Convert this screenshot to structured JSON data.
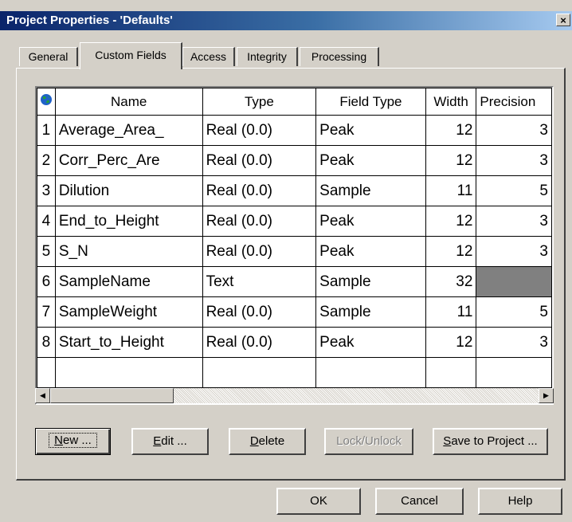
{
  "window": {
    "title": "Project Properties - 'Defaults'",
    "close_glyph": "×"
  },
  "tabs": [
    {
      "label": "General",
      "active": false
    },
    {
      "label": "Custom Fields",
      "active": true
    },
    {
      "label": "Access",
      "active": false
    },
    {
      "label": "Integrity",
      "active": false
    },
    {
      "label": "Processing",
      "active": false
    }
  ],
  "grid": {
    "corner_icon": "globe-icon",
    "columns": [
      "Name",
      "Type",
      "Field Type",
      "Width",
      "Precision"
    ],
    "rows": [
      {
        "num": "1",
        "name": "Average_Area_",
        "type": "Real (0.0)",
        "field_type": "Peak",
        "width": "12",
        "precision": "3"
      },
      {
        "num": "2",
        "name": "Corr_Perc_Are",
        "type": "Real (0.0)",
        "field_type": "Peak",
        "width": "12",
        "precision": "3"
      },
      {
        "num": "3",
        "name": "Dilution",
        "type": "Real (0.0)",
        "field_type": "Sample",
        "width": "11",
        "precision": "5"
      },
      {
        "num": "4",
        "name": "End_to_Height",
        "type": "Real (0.0)",
        "field_type": "Peak",
        "width": "12",
        "precision": "3"
      },
      {
        "num": "5",
        "name": "S_N",
        "type": "Real (0.0)",
        "field_type": "Peak",
        "width": "12",
        "precision": "3"
      },
      {
        "num": "6",
        "name": "SampleName",
        "type": "Text",
        "field_type": "Sample",
        "width": "32",
        "precision": ""
      },
      {
        "num": "7",
        "name": "SampleWeight",
        "type": "Real (0.0)",
        "field_type": "Sample",
        "width": "11",
        "precision": "5"
      },
      {
        "num": "8",
        "name": "Start_to_Height",
        "type": "Real (0.0)",
        "field_type": "Peak",
        "width": "12",
        "precision": "3"
      }
    ]
  },
  "buttons": {
    "new": {
      "pre": "",
      "u": "N",
      "post": "ew ..."
    },
    "edit": {
      "pre": "",
      "u": "E",
      "post": "dit ..."
    },
    "delete": {
      "pre": "",
      "u": "D",
      "post": "elete"
    },
    "lock": {
      "label": "Lock/Unlock"
    },
    "save": {
      "pre": "",
      "u": "S",
      "post": "ave to Project ..."
    }
  },
  "footer": {
    "ok": "OK",
    "cancel": "Cancel",
    "help": "Help"
  }
}
